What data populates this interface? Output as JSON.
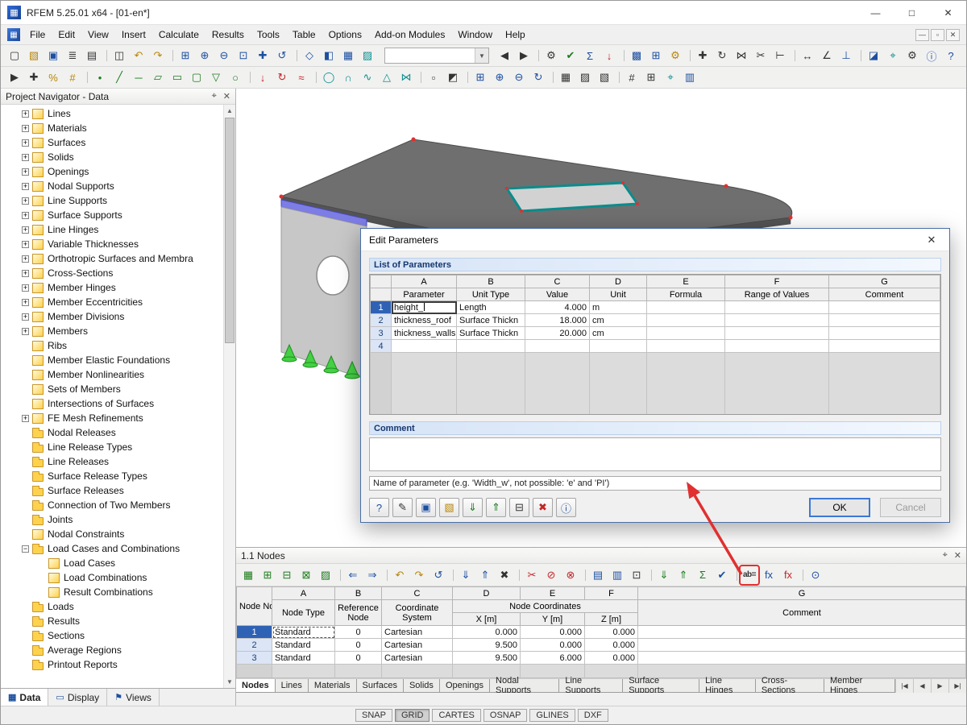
{
  "window": {
    "title": "RFEM 5.25.01 x64 - [01-en*]",
    "app_icon": "▦",
    "controls": {
      "minimize": "—",
      "maximize": "□",
      "close": "✕"
    }
  },
  "menubar": {
    "mdi_icon": "▦",
    "items": [
      "File",
      "Edit",
      "View",
      "Insert",
      "Calculate",
      "Results",
      "Tools",
      "Table",
      "Options",
      "Add-on Modules",
      "Window",
      "Help"
    ],
    "child_controls": [
      "—",
      "▫",
      "✕"
    ]
  },
  "toolbar1": {
    "combo_value": "",
    "pre": [
      {
        "n": "new-model-button",
        "g": "▢",
        "c": "k"
      },
      {
        "n": "open-project-button",
        "g": "▧",
        "c": "y"
      },
      {
        "n": "save-button",
        "g": "▣",
        "c": "b"
      },
      {
        "n": "print-button",
        "g": "≣",
        "c": "k"
      },
      {
        "n": "print-preview-button",
        "g": "▤",
        "c": "k"
      },
      {
        "n": "copy-button",
        "g": "◫",
        "c": "k gs"
      },
      {
        "n": "undo-button",
        "g": "↶",
        "c": "y"
      },
      {
        "n": "redo-button",
        "g": "↷",
        "c": "y"
      },
      {
        "n": "zoom-window-button",
        "g": "⊞",
        "c": "b gs"
      },
      {
        "n": "zoom-in-button",
        "g": "⊕",
        "c": "b"
      },
      {
        "n": "zoom-out-button",
        "g": "⊖",
        "c": "b"
      },
      {
        "n": "zoom-all-button",
        "g": "⊡",
        "c": "b"
      },
      {
        "n": "pan-view-button",
        "g": "✚",
        "c": "b"
      },
      {
        "n": "previous-view-button",
        "g": "↺",
        "c": "b"
      },
      {
        "n": "isometric-view-button",
        "g": "◇",
        "c": "b gs"
      },
      {
        "n": "show-navigator-button",
        "g": "◧",
        "c": "b"
      },
      {
        "n": "show-tables-button",
        "g": "▦",
        "c": "b"
      },
      {
        "n": "render-mode-button",
        "g": "▨",
        "c": "t"
      }
    ],
    "post": [
      {
        "n": "previous-load-case-button",
        "g": "◀",
        "c": "k"
      },
      {
        "n": "next-load-case-button",
        "g": "▶",
        "c": "k"
      },
      {
        "n": "calculation-button",
        "g": "⚙",
        "c": "k gs"
      },
      {
        "n": "check-data-button",
        "g": "✔",
        "c": "g"
      },
      {
        "n": "results-button",
        "g": "Σ",
        "c": "b"
      },
      {
        "n": "loads-display-button",
        "g": "↓",
        "c": "r"
      },
      {
        "n": "fe-mesh-button",
        "g": "▩",
        "c": "b gs"
      },
      {
        "n": "mesh-settings-button",
        "g": "⊞",
        "c": "b"
      },
      {
        "n": "generator-button",
        "g": "⚙",
        "c": "y"
      },
      {
        "n": "move-copy-button",
        "g": "✚",
        "c": "k gs"
      },
      {
        "n": "rotate-button",
        "g": "↻",
        "c": "k"
      },
      {
        "n": "mirror-button",
        "g": "⋈",
        "c": "k"
      },
      {
        "n": "divide-button",
        "g": "✂",
        "c": "k"
      },
      {
        "n": "connect-members-button",
        "g": "⊢",
        "c": "k"
      },
      {
        "n": "dimensions-button",
        "g": "↔",
        "c": "k gs"
      },
      {
        "n": "angle-button",
        "g": "∠",
        "c": "k"
      },
      {
        "n": "axes-button",
        "g": "⊥",
        "c": "b"
      },
      {
        "n": "visibility-button",
        "g": "◪",
        "c": "b gs"
      },
      {
        "n": "work-plane-button",
        "g": "⌖",
        "c": "t"
      },
      {
        "n": "settings-button",
        "g": "⚙",
        "c": "k"
      },
      {
        "n": "info-button",
        "g": "ⓘ",
        "c": "b"
      },
      {
        "n": "help-button",
        "g": "?",
        "c": "b"
      }
    ]
  },
  "toolbar2": {
    "items": [
      {
        "n": "edit-mode-button",
        "g": "▶",
        "c": "k"
      },
      {
        "n": "pick-button",
        "g": "✚",
        "c": "k"
      },
      {
        "n": "snap-percent-button",
        "g": "%",
        "c": "y"
      },
      {
        "n": "guidelines-button",
        "g": "#",
        "c": "y"
      },
      {
        "n": "new-node-button",
        "g": "•",
        "c": "g gs"
      },
      {
        "n": "new-line-button",
        "g": "╱",
        "c": "g"
      },
      {
        "n": "new-member-button",
        "g": "─",
        "c": "g"
      },
      {
        "n": "new-surface-button",
        "g": "▱",
        "c": "g"
      },
      {
        "n": "new-solid-button",
        "g": "▭",
        "c": "g"
      },
      {
        "n": "new-opening-button",
        "g": "▢",
        "c": "g"
      },
      {
        "n": "new-support-button",
        "g": "▽",
        "c": "g"
      },
      {
        "n": "new-hinge-button",
        "g": "○",
        "c": "g"
      },
      {
        "n": "new-load-button",
        "g": "↓",
        "c": "r gs"
      },
      {
        "n": "new-moment-button",
        "g": "↻",
        "c": "r"
      },
      {
        "n": "new-imperfection-button",
        "g": "≈",
        "c": "r"
      },
      {
        "n": "circle-tool-button",
        "g": "◯",
        "c": "t gs"
      },
      {
        "n": "arc-tool-button",
        "g": "∩",
        "c": "t"
      },
      {
        "n": "spline-tool-button",
        "g": "∿",
        "c": "t"
      },
      {
        "n": "polygon-tool-button",
        "g": "△",
        "c": "t"
      },
      {
        "n": "intersection-tool-button",
        "g": "⋈",
        "c": "t"
      },
      {
        "n": "select-all-button",
        "g": "▫",
        "c": "k gs"
      },
      {
        "n": "select-special-button",
        "g": "◩",
        "c": "k"
      },
      {
        "n": "zoom-region-button",
        "g": "⊞",
        "c": "b gs"
      },
      {
        "n": "zoom-in-2-button",
        "g": "⊕",
        "c": "b"
      },
      {
        "n": "zoom-out-2-button",
        "g": "⊖",
        "c": "b"
      },
      {
        "n": "rotate-view-button",
        "g": "↻",
        "c": "b"
      },
      {
        "n": "wireframe-button",
        "g": "▦",
        "c": "k gs"
      },
      {
        "n": "shaded-view-button",
        "g": "▨",
        "c": "k"
      },
      {
        "n": "transparent-view-button",
        "g": "▧",
        "c": "k"
      },
      {
        "n": "numbering-button",
        "g": "#",
        "c": "k gs"
      },
      {
        "n": "grid-toggle-button",
        "g": "⊞",
        "c": "k"
      },
      {
        "n": "workplane-button",
        "g": "⌖",
        "c": "t"
      },
      {
        "n": "panel-toggle-button",
        "g": "▥",
        "c": "b"
      }
    ]
  },
  "navigator": {
    "title": "Project Navigator - Data",
    "pin_icon": "⌖",
    "close_icon": "✕",
    "tree": [
      {
        "label": "Lines",
        "exp": "plus",
        "icon": "item",
        "lvl": "lvl0"
      },
      {
        "label": "Materials",
        "exp": "plus",
        "icon": "item",
        "lvl": "lvl0"
      },
      {
        "label": "Surfaces",
        "exp": "plus",
        "icon": "item",
        "lvl": "lvl0"
      },
      {
        "label": "Solids",
        "exp": "plus",
        "icon": "item",
        "lvl": "lvl0"
      },
      {
        "label": "Openings",
        "exp": "plus",
        "icon": "item",
        "lvl": "lvl0"
      },
      {
        "label": "Nodal Supports",
        "exp": "plus",
        "icon": "item",
        "lvl": "lvl0"
      },
      {
        "label": "Line Supports",
        "exp": "plus",
        "icon": "item",
        "lvl": "lvl0"
      },
      {
        "label": "Surface Supports",
        "exp": "plus",
        "icon": "item",
        "lvl": "lvl0"
      },
      {
        "label": "Line Hinges",
        "exp": "plus",
        "icon": "item",
        "lvl": "lvl0"
      },
      {
        "label": "Variable Thicknesses",
        "exp": "plus",
        "icon": "item",
        "lvl": "lvl0"
      },
      {
        "label": "Orthotropic Surfaces and Membra",
        "exp": "plus",
        "icon": "item",
        "lvl": "lvl0"
      },
      {
        "label": "Cross-Sections",
        "exp": "plus",
        "icon": "item",
        "lvl": "lvl0"
      },
      {
        "label": "Member Hinges",
        "exp": "plus",
        "icon": "item",
        "lvl": "lvl0"
      },
      {
        "label": "Member Eccentricities",
        "exp": "plus",
        "icon": "item",
        "lvl": "lvl0"
      },
      {
        "label": "Member Divisions",
        "exp": "plus",
        "icon": "item",
        "lvl": "lvl0"
      },
      {
        "label": "Members",
        "exp": "plus",
        "icon": "item",
        "lvl": "lvl0"
      },
      {
        "label": "Ribs",
        "exp": "noexp",
        "icon": "item",
        "lvl": "lvl0"
      },
      {
        "label": "Member Elastic Foundations",
        "exp": "noexp",
        "icon": "item",
        "lvl": "lvl0"
      },
      {
        "label": "Member Nonlinearities",
        "exp": "noexp",
        "icon": "item",
        "lvl": "lvl0"
      },
      {
        "label": "Sets of Members",
        "exp": "noexp",
        "icon": "item",
        "lvl": "lvl0"
      },
      {
        "label": "Intersections of Surfaces",
        "exp": "noexp",
        "icon": "item",
        "lvl": "lvl0"
      },
      {
        "label": "FE Mesh Refinements",
        "exp": "plus",
        "icon": "item",
        "lvl": "lvl0"
      },
      {
        "label": "Nodal Releases",
        "exp": "noexp",
        "icon": "folder",
        "lvl": "lvl0"
      },
      {
        "label": "Line Release Types",
        "exp": "noexp",
        "icon": "folder",
        "lvl": "lvl0"
      },
      {
        "label": "Line Releases",
        "exp": "noexp",
        "icon": "folder",
        "lvl": "lvl0"
      },
      {
        "label": "Surface Release Types",
        "exp": "noexp",
        "icon": "folder",
        "lvl": "lvl0"
      },
      {
        "label": "Surface Releases",
        "exp": "noexp",
        "icon": "folder",
        "lvl": "lvl0"
      },
      {
        "label": "Connection of Two Members",
        "exp": "noexp",
        "icon": "folder",
        "lvl": "lvl0"
      },
      {
        "label": "Joints",
        "exp": "noexp",
        "icon": "folder",
        "lvl": "lvl0"
      },
      {
        "label": "Nodal Constraints",
        "exp": "noexp",
        "icon": "item",
        "lvl": "lvl0"
      },
      {
        "label": "Load Cases and Combinations",
        "exp": "minus",
        "icon": "folder",
        "lvl": "lvl0"
      },
      {
        "label": "Load Cases",
        "exp": "noexp",
        "icon": "item",
        "lvl": "lvl1"
      },
      {
        "label": "Load Combinations",
        "exp": "noexp",
        "icon": "item",
        "lvl": "lvl1"
      },
      {
        "label": "Result Combinations",
        "exp": "noexp",
        "icon": "item",
        "lvl": "lvl1"
      },
      {
        "label": "Loads",
        "exp": "noexp",
        "icon": "folder",
        "lvl": "lvl0"
      },
      {
        "label": "Results",
        "exp": "noexp",
        "icon": "folder",
        "lvl": "lvl0"
      },
      {
        "label": "Sections",
        "exp": "noexp",
        "icon": "folder",
        "lvl": "lvl0"
      },
      {
        "label": "Average Regions",
        "exp": "noexp",
        "icon": "folder",
        "lvl": "lvl0"
      },
      {
        "label": "Printout Reports",
        "exp": "noexp",
        "icon": "folder",
        "lvl": "lvl0"
      }
    ],
    "tabs": [
      {
        "label": "Data",
        "icon": "▦",
        "cls": "active"
      },
      {
        "label": "Display",
        "icon": "▭",
        "cls": ""
      },
      {
        "label": "Views",
        "icon": "⚑",
        "cls": ""
      }
    ]
  },
  "dialog": {
    "title": "Edit Parameters",
    "close_icon": "✕",
    "params_label": "List of Parameters",
    "letters": [
      "A",
      "B",
      "C",
      "D",
      "E",
      "F",
      "G"
    ],
    "headers": {
      "parameter": "Parameter",
      "unit_type": "Unit Type",
      "value": "Value",
      "unit": "Unit",
      "formula": "Formula",
      "range": "Range of Values",
      "comment": "Comment"
    },
    "rows": [
      {
        "no": "1",
        "cls": "sel",
        "param": "height_",
        "pcls": "editing",
        "unit_type": "Length",
        "value": "4.000",
        "unit": "m",
        "formula": "",
        "range": "",
        "comment": ""
      },
      {
        "no": "2",
        "cls": "",
        "param": "thickness_roof",
        "pcls": "",
        "unit_type": "Surface Thickn",
        "value": "18.000",
        "unit": "cm",
        "formula": "",
        "range": "",
        "comment": ""
      },
      {
        "no": "3",
        "cls": "",
        "param": "thickness_walls",
        "pcls": "",
        "unit_type": "Surface Thickn",
        "value": "20.000",
        "unit": "cm",
        "formula": "",
        "range": "",
        "comment": ""
      },
      {
        "no": "4",
        "cls": "",
        "param": "",
        "pcls": "",
        "unit_type": "",
        "value": "",
        "unit": "",
        "formula": "",
        "range": "",
        "comment": ""
      }
    ],
    "comment_label": "Comment",
    "comment_value": "",
    "hint": "Name of parameter (e.g. 'Width_w', not possible: 'e' and 'PI')",
    "buttons": [
      {
        "n": "help-button",
        "g": "?",
        "c": "b"
      },
      {
        "n": "edit-comment-button",
        "g": "✎",
        "c": "k"
      },
      {
        "n": "save-parameters-button",
        "g": "▣",
        "c": "b"
      },
      {
        "n": "open-parameters-button",
        "g": "▧",
        "c": "y"
      },
      {
        "n": "import-excel-button",
        "g": "⇓",
        "c": "g"
      },
      {
        "n": "export-excel-button",
        "g": "⇑",
        "c": "g"
      },
      {
        "n": "units-settings-button",
        "g": "⊟",
        "c": "k"
      },
      {
        "n": "delete-all-button",
        "g": "✖",
        "c": "r"
      },
      {
        "n": "info-button",
        "g": "ⓘ",
        "c": "b"
      }
    ],
    "ok_label": "OK",
    "cancel_label": "Cancel"
  },
  "nodes": {
    "title": "1.1 Nodes",
    "pin_icon": "⌖",
    "close_icon": "✕",
    "toolbar": [
      {
        "n": "edit-in-graphic-button",
        "g": "▦",
        "c": "g"
      },
      {
        "n": "new-row-button",
        "g": "⊞",
        "c": "g"
      },
      {
        "n": "insert-row-button",
        "g": "⊟",
        "c": "g"
      },
      {
        "n": "delete-row-button",
        "g": "⊠",
        "c": "g"
      },
      {
        "n": "table-settings-button",
        "g": "▨",
        "c": "g"
      },
      {
        "n": "copy-left-button",
        "g": "⇐",
        "c": "b gs"
      },
      {
        "n": "copy-right-button",
        "g": "⇒",
        "c": "b"
      },
      {
        "n": "undo-table-button",
        "g": "↶",
        "c": "y gs"
      },
      {
        "n": "redo-table-button",
        "g": "↷",
        "c": "y"
      },
      {
        "n": "history-button",
        "g": "↺",
        "c": "b"
      },
      {
        "n": "fill-down-button",
        "g": "⇓",
        "c": "b gs"
      },
      {
        "n": "fill-up-button",
        "g": "⇑",
        "c": "b"
      },
      {
        "n": "clear-cells-button",
        "g": "✖",
        "c": "k"
      },
      {
        "n": "cut-row-button",
        "g": "✂",
        "c": "r gs"
      },
      {
        "n": "delete-rows-button",
        "g": "⊘",
        "c": "r"
      },
      {
        "n": "delete-table-button",
        "g": "⊗",
        "c": "r"
      },
      {
        "n": "view-mode-button",
        "g": "▤",
        "c": "b gs"
      },
      {
        "n": "filter-table-button",
        "g": "▥",
        "c": "b"
      },
      {
        "n": "calculator-button",
        "g": "⊡",
        "c": "k"
      },
      {
        "n": "import-excel-button",
        "g": "⇓",
        "c": "g gs"
      },
      {
        "n": "export-excel-button",
        "g": "⇑",
        "c": "g"
      },
      {
        "n": "sum-button",
        "g": "Σ",
        "c": "g"
      },
      {
        "n": "check-table-button",
        "g": "✔",
        "c": "b"
      },
      {
        "n": "edit-parameters-button",
        "g": "ab=",
        "c": "k hl gs"
      },
      {
        "n": "formula-button",
        "g": "fx",
        "c": "b"
      },
      {
        "n": "formula-invalid-button",
        "g": "fx",
        "c": "r"
      },
      {
        "n": "lock-table-button",
        "g": "⊙",
        "c": "b gs"
      }
    ],
    "letters": [
      "A",
      "B",
      "C",
      "D",
      "E",
      "F",
      "G"
    ],
    "col_node": "Node No.",
    "col_type": "Node Type",
    "col_ref": "Reference Node",
    "col_cs": "Coordinate System",
    "col_nc": "Node Coordinates",
    "col_x": "X [m]",
    "col_y": "Y [m]",
    "col_z": "Z [m]",
    "col_comment": "Comment",
    "rows": [
      {
        "no": "1",
        "cls": "sel",
        "tcls": "cur",
        "type": "Standard",
        "ref": "0",
        "cs": "Cartesian",
        "x": "0.000",
        "y": "0.000",
        "z": "0.000",
        "comment": ""
      },
      {
        "no": "2",
        "cls": "",
        "tcls": "",
        "type": "Standard",
        "ref": "0",
        "cs": "Cartesian",
        "x": "9.500",
        "y": "0.000",
        "z": "0.000",
        "comment": ""
      },
      {
        "no": "3",
        "cls": "",
        "tcls": "",
        "type": "Standard",
        "ref": "0",
        "cs": "Cartesian",
        "x": "9.500",
        "y": "6.000",
        "z": "0.000",
        "comment": ""
      }
    ],
    "tabs": [
      {
        "label": "Nodes",
        "cls": "active"
      },
      {
        "label": "Lines",
        "cls": ""
      },
      {
        "label": "Materials",
        "cls": ""
      },
      {
        "label": "Surfaces",
        "cls": ""
      },
      {
        "label": "Solids",
        "cls": ""
      },
      {
        "label": "Openings",
        "cls": ""
      },
      {
        "label": "Nodal Supports",
        "cls": ""
      },
      {
        "label": "Line Supports",
        "cls": ""
      },
      {
        "label": "Surface Supports",
        "cls": ""
      },
      {
        "label": "Line Hinges",
        "cls": ""
      },
      {
        "label": "Cross-Sections",
        "cls": ""
      },
      {
        "label": "Member Hinges",
        "cls": ""
      }
    ],
    "nav": [
      "|◀",
      "◀",
      "▶",
      "▶|"
    ]
  },
  "statusbar": {
    "toggles": [
      {
        "label": "SNAP",
        "cls": ""
      },
      {
        "label": "GRID",
        "cls": "on"
      },
      {
        "label": "CARTES",
        "cls": ""
      },
      {
        "label": "OSNAP",
        "cls": ""
      },
      {
        "label": "GLINES",
        "cls": ""
      },
      {
        "label": "DXF",
        "cls": ""
      }
    ]
  }
}
